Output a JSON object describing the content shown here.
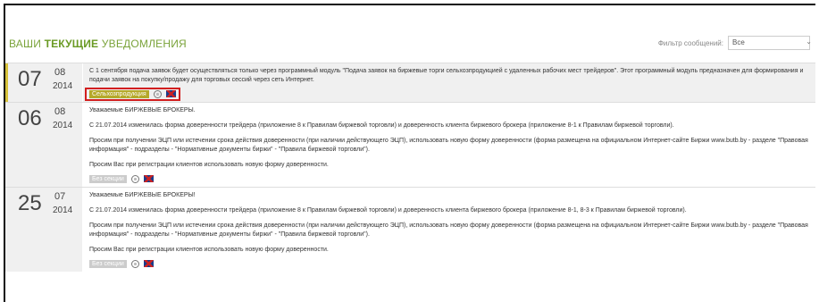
{
  "header": {
    "title_part1": "ВАШИ ",
    "title_part2": "ТЕКУЩИЕ",
    "title_part3": " УВЕДОМЛЕНИЯ",
    "filter_label": "Фильтр сообщений:",
    "filter_value": "Все"
  },
  "items": [
    {
      "day": "07",
      "month": "08",
      "year": "2014",
      "paragraphs": [
        "С 1 сентября подача заявок будет осуществляться только через программный модуль \"Подача заявок на биржевые торги сельхозпродукцией с удаленных рабочих мест трейдеров\". Этот программный модуль предназначен для формирования и подачи заявок на покупку/продажу для торговых сессий через сеть Интернет."
      ],
      "tag": "Сельхозпродукция"
    },
    {
      "day": "06",
      "month": "08",
      "year": "2014",
      "paragraphs": [
        "Уважаемые БИРЖЕВЫЕ БРОКЕРЫ.",
        "С 21.07.2014 изменилась форма доверенности трейдера (приложение 8 к Правилам биржевой торговли) и доверенность клиента биржевого брокера (приложение 8-1 к Правилам биржевой торговли).",
        "Просим при получении ЭЦП или истечении срока действия доверенности (при наличии действующего ЭЦП), использовать новую форму доверенности (форма размещена на официальном Интернет-сайте Биржи www.butb.by - разделе \"Правовая информация\" - подразделы - \"Нормативные документы биржи\" - \"Правила биржевой торговли\").",
        "Просим Вас при регистрации клиентов использовать новую форму доверенности."
      ],
      "tag": "Без секции"
    },
    {
      "day": "25",
      "month": "07",
      "year": "2014",
      "paragraphs": [
        "Уважаемые БИРЖЕВЫЕ БРОКЕРЫ!",
        "С 21.07.2014 изменилась форма доверенности трейдера (приложение 8 к Правилам биржевой торговли) и доверенность клиента биржевого брокера (приложение 8-1, 8-3 к Правилам биржевой торговли).",
        "Просим при получении ЭЦП или истечении срока действия доверенности (при наличии действующего ЭЦП), использовать новую форму доверенности (форма размещена на официальном Интернет-сайте Биржи www.butb.by - разделе \"Правовая информация\" - подразделы - \"Нормативные документы биржи\" - \"Правила биржевой торговли\").",
        "Просим Вас при регистрации клиентов использовать новую форму доверенности."
      ],
      "tag": "Без секции"
    }
  ]
}
